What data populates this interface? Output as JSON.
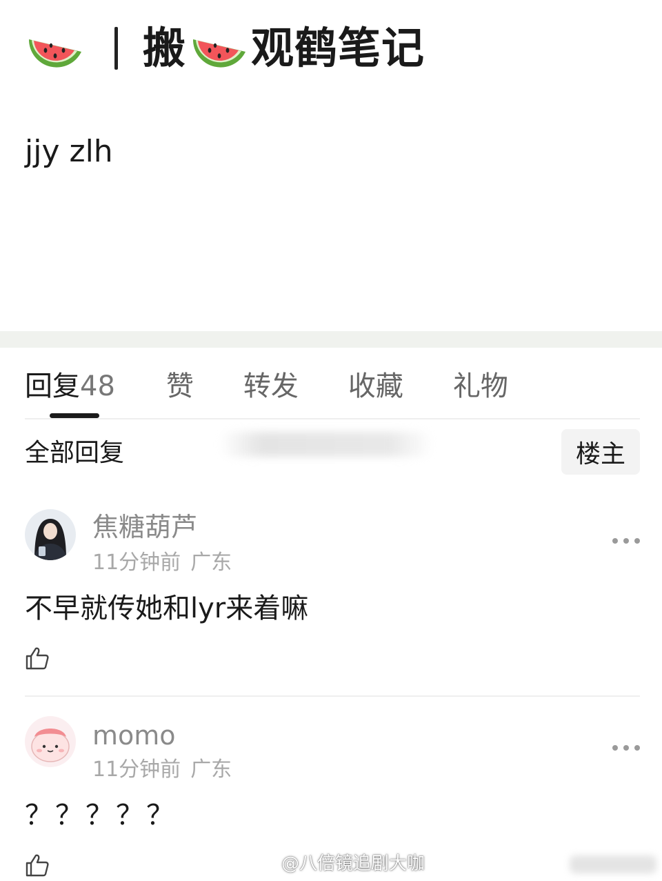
{
  "post": {
    "title_prefix_sep": "|",
    "title_word1": "搬",
    "title_word2": "观鹤笔记",
    "title_emoji": "watermelon-icon",
    "body": "jjy zlh"
  },
  "tabs": [
    {
      "label": "回复",
      "count": "48"
    },
    {
      "label": "赞"
    },
    {
      "label": "转发"
    },
    {
      "label": "收藏"
    },
    {
      "label": "礼物"
    }
  ],
  "filter": {
    "all_replies": "全部回复",
    "op_only": "楼主"
  },
  "comments": [
    {
      "username": "焦糖葫芦",
      "time": "11分钟前",
      "location": "广东",
      "text": "不早就传她和lyr来着嘛",
      "avatar": "avatar-photo"
    },
    {
      "username": "momo",
      "time": "11分钟前",
      "location": "广东",
      "text": "？？？？？",
      "avatar": "avatar-cartoon"
    }
  ],
  "watermark": "@八倍镜追剧大咖",
  "colors": {
    "accent": "#1a1a1a",
    "muted": "#8a8a8a",
    "band": "#f0f2ee",
    "melon_rind": "#5fa83a",
    "melon_flesh": "#f2555a"
  }
}
